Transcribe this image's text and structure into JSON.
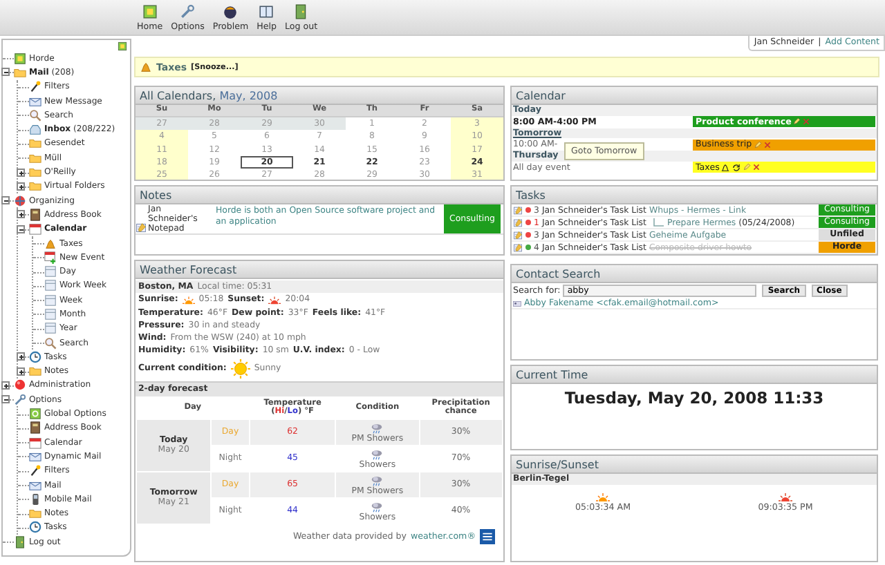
{
  "toolbar": [
    {
      "label": "Home",
      "kind": "logo"
    },
    {
      "label": "Options",
      "kind": "wrench"
    },
    {
      "label": "Problem",
      "kind": "problem"
    },
    {
      "label": "Help",
      "kind": "help"
    },
    {
      "label": "Log out",
      "kind": "door"
    }
  ],
  "user_bar": {
    "user": "Jan Schneider",
    "separator": "|",
    "link": "Add Content"
  },
  "sidebar": {
    "items": [
      {
        "label": "Horde",
        "kind": "logo",
        "bold": false
      },
      {
        "label": "Mail",
        "count": "(208)",
        "kind": "folder",
        "bold": true,
        "expanded": true,
        "children": [
          {
            "label": "Filters",
            "kind": "wand",
            "bold": false
          },
          {
            "label": "New Message",
            "kind": "compose",
            "bold": false
          },
          {
            "label": "Search",
            "kind": "search",
            "bold": false
          },
          {
            "label": "Inbox",
            "count": "(208/222)",
            "kind": "inbox",
            "bold": true
          },
          {
            "label": "Gesendet",
            "kind": "folder",
            "bold": false
          },
          {
            "label": "Müll",
            "kind": "folder",
            "bold": false
          },
          {
            "label": "O'Reilly",
            "kind": "folder",
            "bold": false,
            "expanded": false
          },
          {
            "label": "Virtual Folders",
            "kind": "folder",
            "bold": false,
            "expanded": false
          }
        ]
      },
      {
        "label": "Organizing",
        "kind": "globe",
        "bold": false,
        "expanded": true,
        "children": [
          {
            "label": "Address Book",
            "kind": "book",
            "bold": false,
            "expanded": false
          },
          {
            "label": "Calendar",
            "kind": "calendar",
            "bold": true,
            "expanded": true,
            "children": [
              {
                "label": "Taxes",
                "kind": "bell",
                "bold": false
              },
              {
                "label": "New Event",
                "kind": "event",
                "bold": false
              },
              {
                "label": "Day",
                "kind": "page",
                "bold": false
              },
              {
                "label": "Work Week",
                "kind": "page",
                "bold": false
              },
              {
                "label": "Week",
                "kind": "page",
                "bold": false
              },
              {
                "label": "Month",
                "kind": "page",
                "bold": false
              },
              {
                "label": "Year",
                "kind": "page",
                "bold": false
              },
              {
                "label": "Search",
                "kind": "search",
                "bold": false
              }
            ]
          },
          {
            "label": "Tasks",
            "kind": "clock",
            "bold": false,
            "expanded": false
          },
          {
            "label": "Notes",
            "kind": "folder",
            "bold": false,
            "expanded": false
          }
        ]
      },
      {
        "label": "Administration",
        "kind": "ball",
        "bold": false,
        "expanded": false
      },
      {
        "label": "Options",
        "kind": "wrench",
        "bold": false,
        "expanded": true,
        "children": [
          {
            "label": "Global Options",
            "kind": "gear",
            "bold": false
          },
          {
            "label": "Address Book",
            "kind": "book",
            "bold": false
          },
          {
            "label": "Calendar",
            "kind": "calendar",
            "bold": false
          },
          {
            "label": "Dynamic Mail",
            "kind": "compose",
            "bold": false
          },
          {
            "label": "Filters",
            "kind": "wand",
            "bold": false
          },
          {
            "label": "Mail",
            "kind": "compose",
            "bold": false
          },
          {
            "label": "Mobile Mail",
            "kind": "phone",
            "bold": false
          },
          {
            "label": "Notes",
            "kind": "folder",
            "bold": false
          },
          {
            "label": "Tasks",
            "kind": "clock",
            "bold": false
          }
        ]
      },
      {
        "label": "Log out",
        "kind": "door",
        "bold": false
      }
    ]
  },
  "alert": {
    "title": "Taxes",
    "action": "[Snooze...]"
  },
  "month_calendar": {
    "title": "All Calendars,",
    "month": "May, 2008",
    "weekdays": [
      "Su",
      "Mo",
      "Tu",
      "We",
      "Th",
      "Fr",
      "Sa"
    ],
    "weeks": [
      [
        {
          "day": "27",
          "kind": "outside",
          "events": false,
          "selected": false
        },
        {
          "day": "28",
          "kind": "outside",
          "events": false,
          "selected": false
        },
        {
          "day": "29",
          "kind": "outside",
          "events": false,
          "selected": false
        },
        {
          "day": "30",
          "kind": "outside",
          "events": false,
          "selected": false
        },
        {
          "day": "1",
          "kind": "weekday",
          "events": false,
          "selected": false
        },
        {
          "day": "2",
          "kind": "weekday",
          "events": false,
          "selected": false
        },
        {
          "day": "3",
          "kind": "weekend",
          "events": false,
          "selected": false
        }
      ],
      [
        {
          "day": "4",
          "kind": "weekend",
          "events": false,
          "selected": false
        },
        {
          "day": "5",
          "kind": "weekday",
          "events": false,
          "selected": false
        },
        {
          "day": "6",
          "kind": "weekday",
          "events": false,
          "selected": false
        },
        {
          "day": "7",
          "kind": "weekday",
          "events": false,
          "selected": false
        },
        {
          "day": "8",
          "kind": "weekday",
          "events": false,
          "selected": false
        },
        {
          "day": "9",
          "kind": "weekday",
          "events": false,
          "selected": false
        },
        {
          "day": "10",
          "kind": "weekend",
          "events": false,
          "selected": false
        }
      ],
      [
        {
          "day": "11",
          "kind": "weekend",
          "events": false,
          "selected": false
        },
        {
          "day": "12",
          "kind": "weekday",
          "events": false,
          "selected": false
        },
        {
          "day": "13",
          "kind": "weekday",
          "events": false,
          "selected": false
        },
        {
          "day": "14",
          "kind": "weekday",
          "events": false,
          "selected": false
        },
        {
          "day": "15",
          "kind": "weekday",
          "events": false,
          "selected": false
        },
        {
          "day": "16",
          "kind": "weekday",
          "events": false,
          "selected": false
        },
        {
          "day": "17",
          "kind": "weekend",
          "events": false,
          "selected": false
        }
      ],
      [
        {
          "day": "18",
          "kind": "weekend",
          "events": false,
          "selected": false
        },
        {
          "day": "19",
          "kind": "weekday",
          "events": false,
          "selected": false
        },
        {
          "day": "20",
          "kind": "weekday",
          "events": true,
          "selected": true
        },
        {
          "day": "21",
          "kind": "weekday",
          "events": true,
          "selected": false
        },
        {
          "day": "22",
          "kind": "weekday",
          "events": true,
          "selected": false
        },
        {
          "day": "23",
          "kind": "weekday",
          "events": false,
          "selected": false
        },
        {
          "day": "24",
          "kind": "weekend",
          "events": true,
          "selected": false
        }
      ],
      [
        {
          "day": "25",
          "kind": "weekend",
          "events": false,
          "selected": false
        },
        {
          "day": "26",
          "kind": "weekday",
          "events": false,
          "selected": false
        },
        {
          "day": "27",
          "kind": "weekday",
          "events": false,
          "selected": false
        },
        {
          "day": "28",
          "kind": "weekday",
          "events": false,
          "selected": false
        },
        {
          "day": "29",
          "kind": "weekday",
          "events": false,
          "selected": false
        },
        {
          "day": "30",
          "kind": "weekday",
          "events": false,
          "selected": false
        },
        {
          "day": "31",
          "kind": "weekend",
          "events": false,
          "selected": false
        }
      ]
    ]
  },
  "notes": {
    "title": "Notes",
    "rows": [
      {
        "notepad": "Jan Schneider's Notepad",
        "text": "Horde is both an Open Source software project and an application",
        "category": "Consulting",
        "color": "#1e9e1e"
      }
    ]
  },
  "weather": {
    "title": "Weather Forecast",
    "lines": [
      [
        {
          "label": "Boston, MA",
          "value": "Local time: 05:31"
        }
      ],
      [
        {
          "label": "Sunrise:",
          "kind": "sunrise",
          "value": "05:18"
        },
        {
          "label": "Sunset:",
          "kind": "sunset",
          "value": "20:04"
        }
      ],
      [
        {
          "label": "Temperature:",
          "value": "46°F"
        },
        {
          "label": "Dew point:",
          "value": "33°F"
        },
        {
          "label": "Feels like:",
          "value": "41°F"
        }
      ],
      [
        {
          "label": "Pressure:",
          "value": "30 in and steady"
        }
      ],
      [
        {
          "label": "Wind:",
          "value": "From the WSW (240) at 10 mph"
        }
      ],
      [
        {
          "label": "Humidity:",
          "value": "61%"
        },
        {
          "label": "Visibility:",
          "value": "10 sm"
        },
        {
          "label": "U.V. index:",
          "value": "0 - Low"
        }
      ]
    ],
    "current": {
      "label": "Current condition:",
      "kind": "sun",
      "value": "Sunny"
    },
    "forecast": {
      "title": "2-day forecast",
      "day_header": "Day",
      "temp_header": {
        "label": "Temperature",
        "open": "(",
        "hi": "Hi",
        "sep": "/",
        "lo": "Lo",
        "close": ")",
        "unit": "°F"
      },
      "condition_header": "Condition",
      "precip_header": "Precipitation chance",
      "days": [
        {
          "name": "Today",
          "date": "May 20",
          "periods": [
            {
              "period": "Day",
              "kind": "day",
              "temp": "62",
              "condition": "PM Showers",
              "precip": "30%"
            },
            {
              "period": "Night",
              "kind": "night",
              "temp": "45",
              "condition": "Showers",
              "precip": "70%"
            }
          ]
        },
        {
          "name": "Tomorrow",
          "date": "May 21",
          "periods": [
            {
              "period": "Day",
              "kind": "day",
              "temp": "65",
              "condition": "PM Showers",
              "precip": "30%"
            },
            {
              "period": "Night",
              "kind": "night",
              "temp": "44",
              "condition": "Showers",
              "precip": "40%"
            }
          ]
        }
      ]
    },
    "credit": {
      "text": "Weather data provided by",
      "link": "weather.com®"
    }
  },
  "day_calendar": {
    "title": "Calendar",
    "groups": [
      {
        "heading": "Today",
        "today": true,
        "link": false,
        "events": [
          {
            "time": "8:00 AM-4:00 PM",
            "title": "Product conference",
            "color": "#1e9e1e",
            "alarm": false,
            "recurring": false
          }
        ]
      },
      {
        "heading": "Tomorrow",
        "today": false,
        "link": true,
        "tooltip": "Goto Tomorrow",
        "events": [
          {
            "time": "10:00 AM-",
            "title": "Business trip",
            "color": "#f0a000",
            "alarm": false,
            "recurring": false
          }
        ]
      },
      {
        "heading": "Thursday",
        "today": false,
        "link": false,
        "events": [
          {
            "time": "All day event",
            "title": "Taxes",
            "color": "#ffff22",
            "alarm": true,
            "recurring": true
          }
        ]
      }
    ]
  },
  "tasks": {
    "title": "Tasks",
    "rows": [
      {
        "priority": "3",
        "urgent": false,
        "tasklist": "Jan Schneider's Task List",
        "name": "Whups - Hermes - Link",
        "subtask": false,
        "completed": false,
        "category": "Consulting",
        "color": "#1e9e1e"
      },
      {
        "priority": "1",
        "urgent": true,
        "tasklist": "Jan Schneider's Task List",
        "name": "Prepare Hermes",
        "due": "(05/24/2008)",
        "subtask": true,
        "completed": false,
        "category": "Consulting",
        "color": "#1e9e1e"
      },
      {
        "priority": "3",
        "urgent": false,
        "tasklist": "Jan Schneider's Task List",
        "name": "Geheime Aufgabe",
        "subtask": false,
        "completed": false,
        "category": "Unfiled",
        "color": "#dddddd"
      },
      {
        "priority": "4",
        "urgent": false,
        "tasklist": "Jan Schneider's Task List",
        "name": "Composite driver howto",
        "subtask": false,
        "completed": true,
        "category": "Horde",
        "color": "#f0a000"
      }
    ]
  },
  "contact_search": {
    "title": "Contact Search",
    "label": "Search for:",
    "value": "abby",
    "buttons": [
      "Search",
      "Close"
    ],
    "results": [
      "Abby Fakename <cfak.email@hotmail.com>"
    ]
  },
  "current_time": {
    "title": "Current Time",
    "value": "Tuesday, May 20, 2008 11:33"
  },
  "sun": {
    "title": "Sunrise/Sunset",
    "location": "Berlin-Tegel",
    "sunrise": "05:03:34 AM",
    "sunset": "09:03:35 PM"
  }
}
